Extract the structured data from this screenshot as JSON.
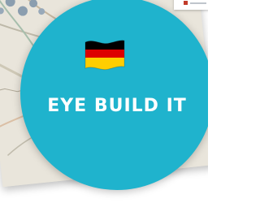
{
  "badge": {
    "title": "EYE BUILD IT",
    "background_color": "#1fb3cd",
    "text_color": "#ffffff",
    "flag_icon": "germany-flag-icon"
  },
  "map": {
    "icons": [
      "map-pin-icon"
    ]
  },
  "flag_colors": [
    "#000000",
    "#dd0000",
    "#ffce00"
  ]
}
